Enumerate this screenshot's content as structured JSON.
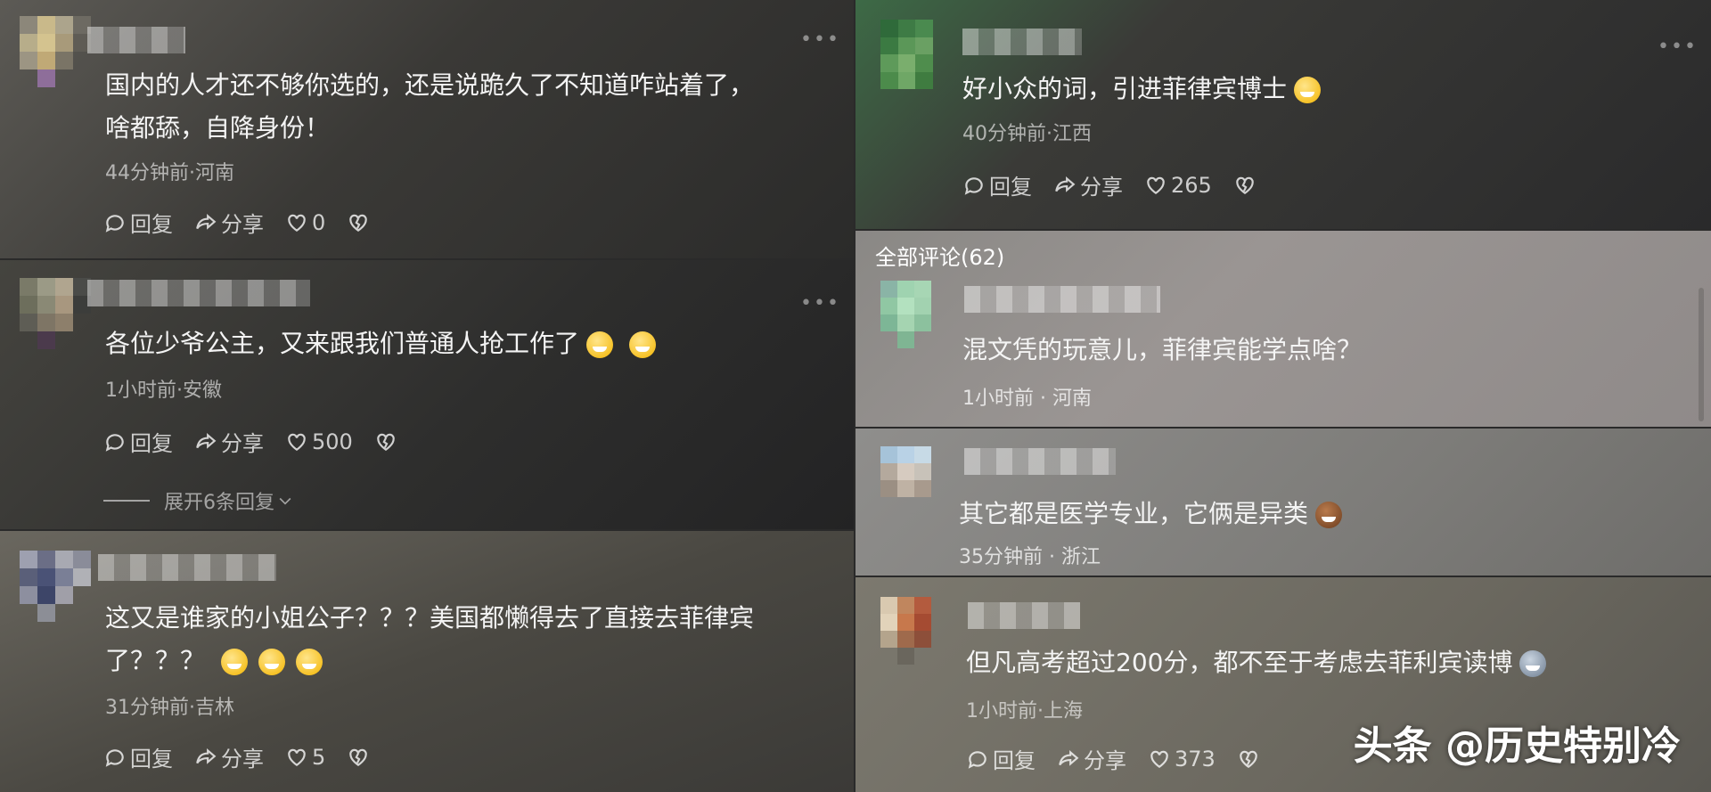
{
  "section_title": "全部评论(62)",
  "watermark": "头条 @历史特别冷",
  "actions": {
    "reply": "回复",
    "share": "分享"
  },
  "comments": [
    {
      "text_line1": "国内的人才还不够你选的，还是说跪久了不知道咋站着了，",
      "text_line2": "啥都舔，自降身份！",
      "meta": "44分钟前·河南",
      "likes": "0"
    },
    {
      "text_line1": "各位少爷公主，又来跟我们普通人抢工作了",
      "meta": "1小时前·安徽",
      "likes": "500",
      "expand": "展开6条回复"
    },
    {
      "text_line1": "这又是谁家的小姐公子？？？美国都懒得去了直接去菲律宾",
      "text_line2": "了？？？",
      "meta": "31分钟前·吉林",
      "likes": "5"
    },
    {
      "text_line1": "好小众的词，引进菲律宾博士",
      "meta": "40分钟前·江西",
      "likes": "265"
    },
    {
      "text_line1": "混文凭的玩意儿，菲律宾能学点啥？",
      "meta": "1小时前 · 河南"
    },
    {
      "text_line1": "其它都是医学专业，它俩是异类",
      "meta": "35分钟前 · 浙江"
    },
    {
      "text_line1": "但凡高考超过200分，都不至于考虑去菲利宾读博",
      "meta": "1小时前·上海",
      "likes": "373"
    }
  ],
  "icons": [
    "reply-icon",
    "share-icon",
    "like-heart-icon",
    "dislike-heart-icon",
    "more-icon",
    "chevron-down-icon",
    "laughing-emoji-icon",
    "grin-emoji-icon",
    "poop-emoji-icon",
    "cat-emoji-icon"
  ]
}
